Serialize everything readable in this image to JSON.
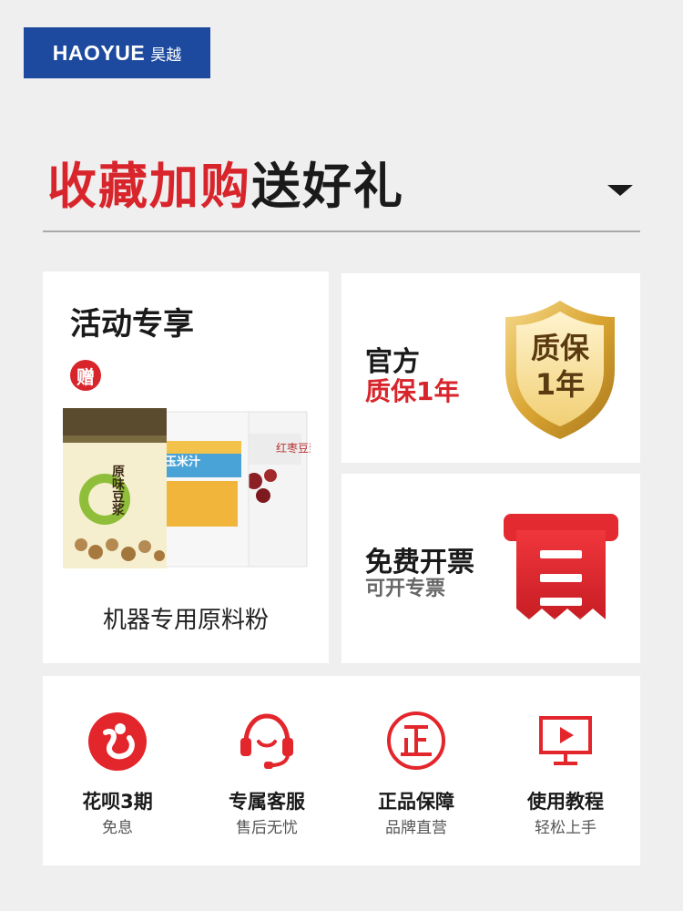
{
  "brand": {
    "logo_text": "HAOYUE",
    "logo_cn": "昊越",
    "color": "#1d4a9e"
  },
  "headline": {
    "part_red": "收藏加购",
    "part_dark": "送好礼"
  },
  "promo": {
    "title": "活动专享",
    "gift_badge": "赠",
    "package_labels": [
      "原味豆浆",
      "玉米汁",
      "红枣豆浆"
    ],
    "caption": "机器专用原料粉"
  },
  "warranty": {
    "title": "官方",
    "subtitle": "质保1年",
    "badge_line1": "质保",
    "badge_line2": "1年"
  },
  "invoice": {
    "title": "免费开票",
    "subtitle": "可开专票"
  },
  "services": [
    {
      "title": "花呗3期",
      "subtitle": "免息",
      "icon": "huabei-icon"
    },
    {
      "title": "专属客服",
      "subtitle": "售后无忧",
      "icon": "headset-icon"
    },
    {
      "title": "正品保障",
      "subtitle": "品牌直营",
      "icon": "genuine-icon"
    },
    {
      "title": "使用教程",
      "subtitle": "轻松上手",
      "icon": "video-tutorial-icon"
    }
  ],
  "colors": {
    "accent": "#d8252c",
    "text": "#1a1a1a",
    "background": "#efefef",
    "gold": "#d9a531"
  }
}
